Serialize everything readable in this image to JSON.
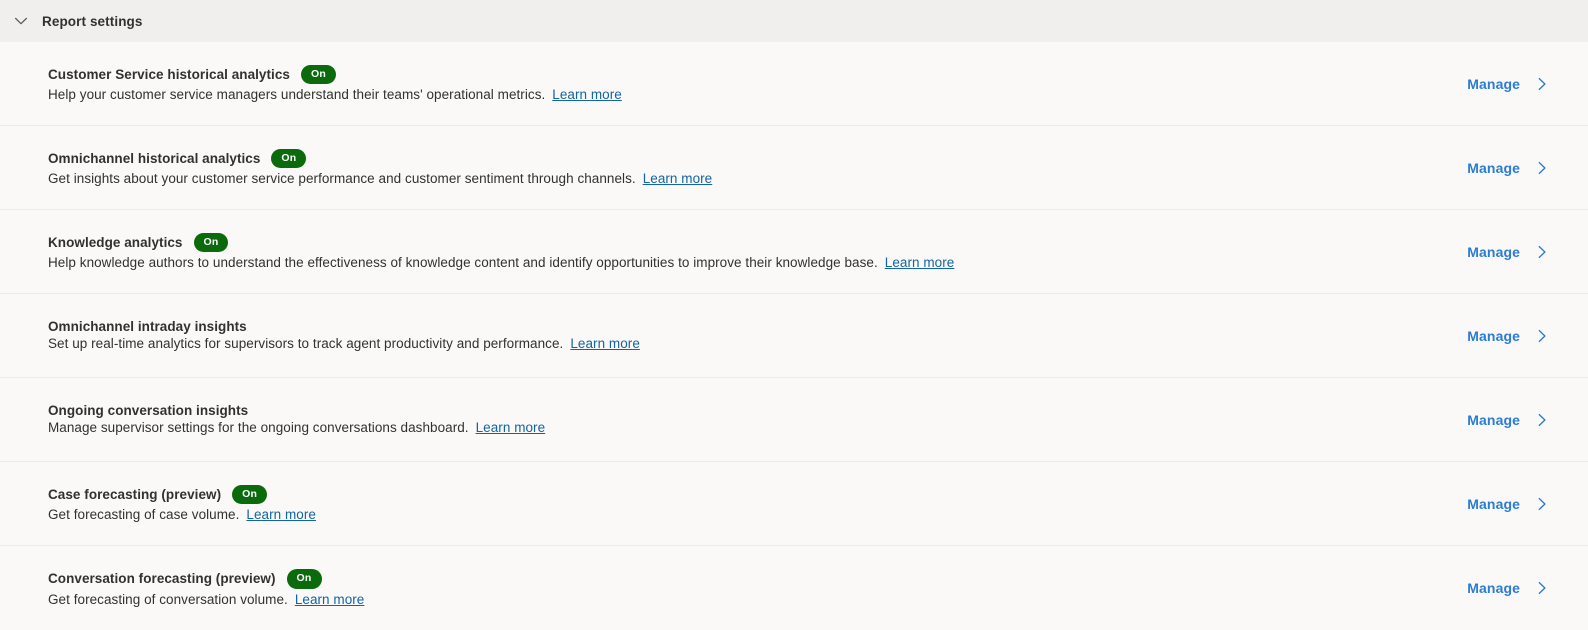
{
  "header": {
    "title": "Report settings",
    "collapse_icon": "chevron-down-icon",
    "expanded": true
  },
  "common": {
    "manage_label": "Manage",
    "manage_chevron_icon": "chevron-right-icon",
    "learn_more_label": "Learn more",
    "badge_on_label": "On",
    "accent_link_color": "#2b7cd3",
    "badge_color": "#0b6a0b",
    "header_bg": "#f0efee",
    "body_bg": "#faf9f8",
    "divider_color": "#edebe9"
  },
  "rows": [
    {
      "title": "Customer Service historical analytics",
      "badge": "On",
      "description": "Help your customer service managers understand their teams' operational metrics.",
      "learn_more": "Learn more",
      "manage": "Manage"
    },
    {
      "title": "Omnichannel historical analytics",
      "badge": "On",
      "description": "Get insights about your customer service performance and customer sentiment through channels.",
      "learn_more": "Learn more",
      "manage": "Manage"
    },
    {
      "title": "Knowledge analytics",
      "badge": "On",
      "description": "Help knowledge authors to understand the effectiveness of knowledge content and identify opportunities to improve their knowledge base.",
      "learn_more": "Learn more",
      "manage": "Manage"
    },
    {
      "title": "Omnichannel intraday insights",
      "badge": "",
      "description": "Set up real-time analytics for supervisors to track agent productivity and performance.",
      "learn_more": "Learn more",
      "manage": "Manage"
    },
    {
      "title": "Ongoing conversation insights",
      "badge": "",
      "description": "Manage supervisor settings for the ongoing conversations dashboard.",
      "learn_more": "Learn more",
      "manage": "Manage"
    },
    {
      "title": "Case forecasting (preview)",
      "badge": "On",
      "description": "Get forecasting of case volume.",
      "learn_more": "Learn more",
      "manage": "Manage"
    },
    {
      "title": "Conversation forecasting (preview)",
      "badge": "On",
      "description": "Get forecasting of conversation volume.",
      "learn_more": "Learn more",
      "manage": "Manage"
    }
  ]
}
